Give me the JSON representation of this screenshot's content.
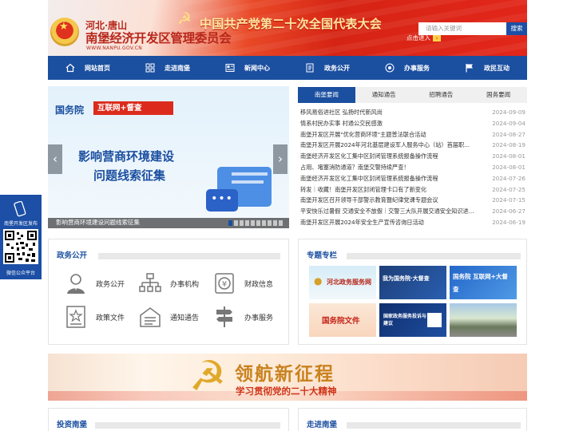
{
  "header": {
    "region": "河北·唐山",
    "org_name": "南堡经济开发区管理委员会",
    "url_text": "WWW.NANPU.GOV.CN",
    "slogan": "中国共产党第二十次全国代表大会",
    "enter_link": "点击进入",
    "search_placeholder": "请输入关键词",
    "search_button": "搜索"
  },
  "nav": {
    "items": [
      {
        "label": "网站首页",
        "icon": "home-icon"
      },
      {
        "label": "走进南堡",
        "icon": "grid-icon"
      },
      {
        "label": "新闻中心",
        "icon": "newspaper-icon"
      },
      {
        "label": "政务公开",
        "icon": "document-icon"
      },
      {
        "label": "办事服务",
        "icon": "target-icon"
      },
      {
        "label": "政民互动",
        "icon": "flag-icon"
      }
    ]
  },
  "slider": {
    "org_tag": "国务院",
    "badge": "互联网+督查",
    "title_line1": "影响营商环境建设",
    "title_line2": "问题线索征集",
    "caption": "影响营商环境建设问题线索征集",
    "prev": "‹",
    "next": "›"
  },
  "news": {
    "tabs": [
      "南堡要闻",
      "通知通告",
      "招聘通告",
      "国务要闻"
    ],
    "active_tab": 0,
    "items": [
      {
        "title": "移风易俗进社区 弘扬时代新风尚",
        "date": "2024-09-09"
      },
      {
        "title": "情系村民办实事 村通公交民感激",
        "date": "2024-09-04"
      },
      {
        "title": "南堡开发区开展\"优化营商环境\"主题普法联合活动",
        "date": "2024-08-27"
      },
      {
        "title": "南堡开发区开展2024年河北基层建设军人服务中心（站）首届职...",
        "date": "2024-08-19"
      },
      {
        "title": "南堡经济开发区化工集中区封闭管理系统报备操作流程",
        "date": "2024-08-01"
      },
      {
        "title": "占用、堵塞消防通道？南堡交警持续严查！",
        "date": "2024-08-01"
      },
      {
        "title": "南堡经济开发区化工集中区封闭管理系统报备操作流程",
        "date": "2024-07-26"
      },
      {
        "title": "转发｜收藏！南堡开发区封闭管理卡口有了新变化",
        "date": "2024-07-25"
      },
      {
        "title": "南堡开发区召开领导干部警示教育暨纪律党课专题会议",
        "date": "2024-07-15"
      },
      {
        "title": "平安快乐过暑假 交通安全不放假｜交警三大队开展交通安全知识进...",
        "date": "2024-06-27"
      },
      {
        "title": "南堡开发区开展2024年安全生产宣传咨询日活动",
        "date": "2024-06-19"
      }
    ]
  },
  "float_widget": {
    "caption_top": "南堡开发区发布",
    "caption_bottom": "微信公众平台"
  },
  "affairs": {
    "heading": "政务公开",
    "items": [
      {
        "label": "政务公开",
        "icon": "person-icon"
      },
      {
        "label": "办事机构",
        "icon": "org-chart-icon"
      },
      {
        "label": "财政信息",
        "icon": "yen-coin-icon"
      },
      {
        "label": "政策文件",
        "icon": "star-document-icon"
      },
      {
        "label": "通知通告",
        "icon": "notice-icon"
      },
      {
        "label": "办事服务",
        "icon": "signpost-icon"
      }
    ]
  },
  "topics": {
    "heading": "专题专栏",
    "items": [
      {
        "label": "河北政务服务网",
        "icon": "hebei-service-banner"
      },
      {
        "label": "我为国务院·大督查",
        "icon": "supervision-banner"
      },
      {
        "label": "国务院 互联网+大督查",
        "icon": "internet-supervision-banner"
      },
      {
        "label": "国务院文件",
        "icon": "state-council-docs-banner"
      },
      {
        "label": "国家政务服务投诉与建议",
        "icon": "complaint-banner"
      },
      {
        "label": "",
        "icon": "highway-banner"
      }
    ]
  },
  "banner": {
    "title": "领航新征程",
    "subtitle": "学习贯彻党的二十大精神"
  },
  "bottom": {
    "left_heading": "投资南堡",
    "right_heading": "走进南堡"
  }
}
